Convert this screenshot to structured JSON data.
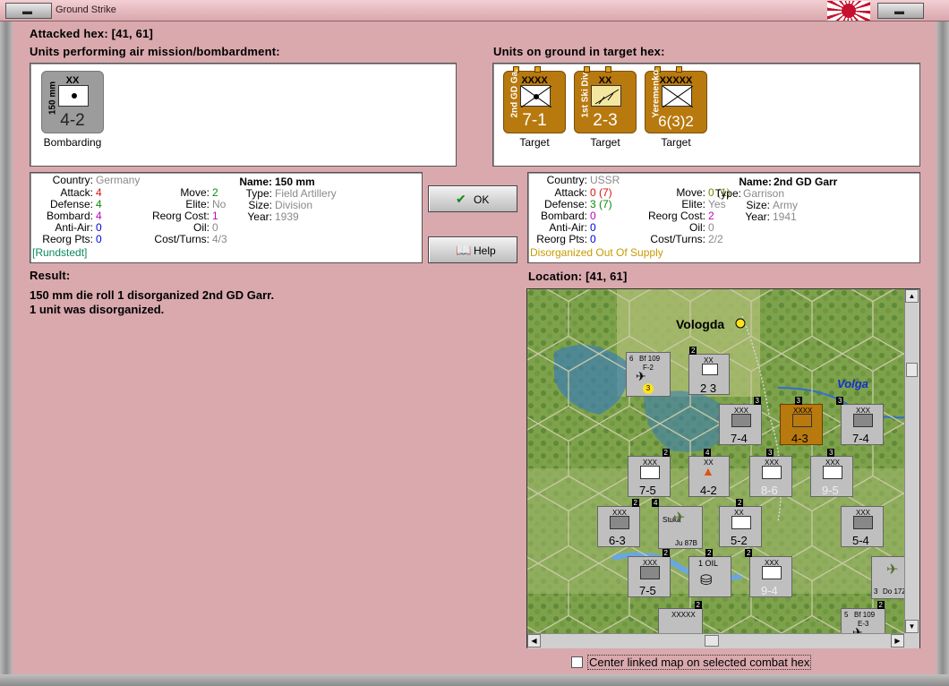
{
  "window": {
    "title": "Ground Strike"
  },
  "attacked_hex": {
    "label": "Attacked hex:",
    "value": "[41, 61]"
  },
  "air_units": {
    "heading": "Units performing air mission/bombardment:",
    "items": [
      {
        "name": "150 mm",
        "size": "XX",
        "vals": "4-2",
        "caption": "Bombarding"
      }
    ]
  },
  "ground_units": {
    "heading": "Units on ground in target hex:",
    "items": [
      {
        "name": "2nd GD Ga.",
        "size": "XXXX",
        "vals": "7-1",
        "caption": "Target"
      },
      {
        "name": "1st Ski Div",
        "size": "XX",
        "vals": "2-3",
        "caption": "Target"
      },
      {
        "name": "Yeremenko",
        "size": "XXXXX",
        "vals": "6(3)2",
        "caption": "Target"
      }
    ]
  },
  "left_info": {
    "country_l": "Country:",
    "country_v": "Germany",
    "attack_l": "Attack:",
    "attack_v": "4",
    "defense_l": "Defense:",
    "defense_v": "4",
    "bombard_l": "Bombard:",
    "bombard_v": "4",
    "aa_l": "Anti-Air:",
    "aa_v": "0",
    "reorgpts_l": "Reorg Pts:",
    "reorgpts_v": "0",
    "commander": "[Rundstedt]",
    "move_l": "Move:",
    "move_v": "2",
    "elite_l": "Elite:",
    "elite_v": "No",
    "reorgcost_l": "Reorg Cost:",
    "reorgcost_v": "1",
    "oil_l": "Oil:",
    "oil_v": "0",
    "costturns_l": "Cost/Turns:",
    "costturns_v": "4/3",
    "name_l": "Name:",
    "name_v": "150 mm",
    "type_l": "Type:",
    "type_v": "Field Artillery",
    "size_l": "Size:",
    "size_v": "Division",
    "year_l": "Year:",
    "year_v": "1939"
  },
  "right_info": {
    "country_l": "Country:",
    "country_v": "USSR",
    "attack_l": "Attack:",
    "attack_v": "0 (7)",
    "defense_l": "Defense:",
    "defense_v": "3 (7)",
    "bombard_l": "Bombard:",
    "bombard_v": "0",
    "aa_l": "Anti-Air:",
    "aa_v": "0",
    "reorgpts_l": "Reorg Pts:",
    "reorgpts_v": "0",
    "status": "Disorganized Out Of Supply",
    "move_l": "Move:",
    "move_v": "0 (1)",
    "elite_l": "Elite:",
    "elite_v": "Yes",
    "reorgcost_l": "Reorg Cost:",
    "reorgcost_v": "2",
    "oil_l": "Oil:",
    "oil_v": "0",
    "costturns_l": "Cost/Turns:",
    "costturns_v": "2/2",
    "name_l": "Name:",
    "name_v": "2nd GD Garr",
    "type_l": "Type:",
    "type_v": "Garrison",
    "size_l": "Size:",
    "size_v": "Army",
    "year_l": "Year:",
    "year_v": "1941"
  },
  "buttons": {
    "ok": "OK",
    "help": "Help"
  },
  "result": {
    "heading": "Result:",
    "line1": "150 mm die roll 1 disorganized 2nd GD Garr.",
    "line2": "1 unit was disorganized."
  },
  "location": {
    "label": "Location:",
    "value": "[41, 61]"
  },
  "map": {
    "city": "Vologda",
    "river": "Volga",
    "counters": [
      {
        "top": "6",
        "top2": "Bf 109",
        "mid": "F-2",
        "vals": "3",
        "stack": ""
      },
      {
        "top": "XX",
        "vals": "2 3",
        "stack": "2"
      },
      {
        "top": "XXX",
        "vals": "7-4",
        "stack": "3"
      },
      {
        "top": "XXXX",
        "vals": "4-3",
        "stack": "3"
      },
      {
        "top": "XXX",
        "vals": "7-4",
        "stack": "3"
      },
      {
        "top": "XXX",
        "vals": "7-5",
        "stack": "2"
      },
      {
        "top": "XX",
        "vals": "4-2",
        "stack": "4"
      },
      {
        "top": "XXX",
        "vals": "8-6",
        "stack": "3"
      },
      {
        "top": "XXX",
        "vals": "9-5",
        "stack": "3"
      },
      {
        "top": "XXX",
        "vals": "6-3",
        "stack": "2"
      },
      {
        "top": "Stuka",
        "vals": "Ju 87B",
        "stack": "4"
      },
      {
        "top": "XX",
        "vals": "5-2",
        "stack": "2"
      },
      {
        "top": "XXX",
        "vals": "5-4",
        "stack": ""
      },
      {
        "top": "XXX",
        "vals": "7-5",
        "stack": "2"
      },
      {
        "top": "1 OIL",
        "vals": "",
        "stack": "2"
      },
      {
        "top": "XXX",
        "vals": "9-4",
        "stack": "2"
      },
      {
        "top": "3",
        "vals": "Do 17Z",
        "stack": ""
      },
      {
        "top": "XXXXX",
        "vals": "",
        "stack": "2"
      },
      {
        "top": "5",
        "top2": "Bf 109",
        "mid": "E-3",
        "vals": "",
        "stack": "2"
      }
    ]
  },
  "footer": {
    "center_label": "Center linked map on selected combat hex"
  }
}
